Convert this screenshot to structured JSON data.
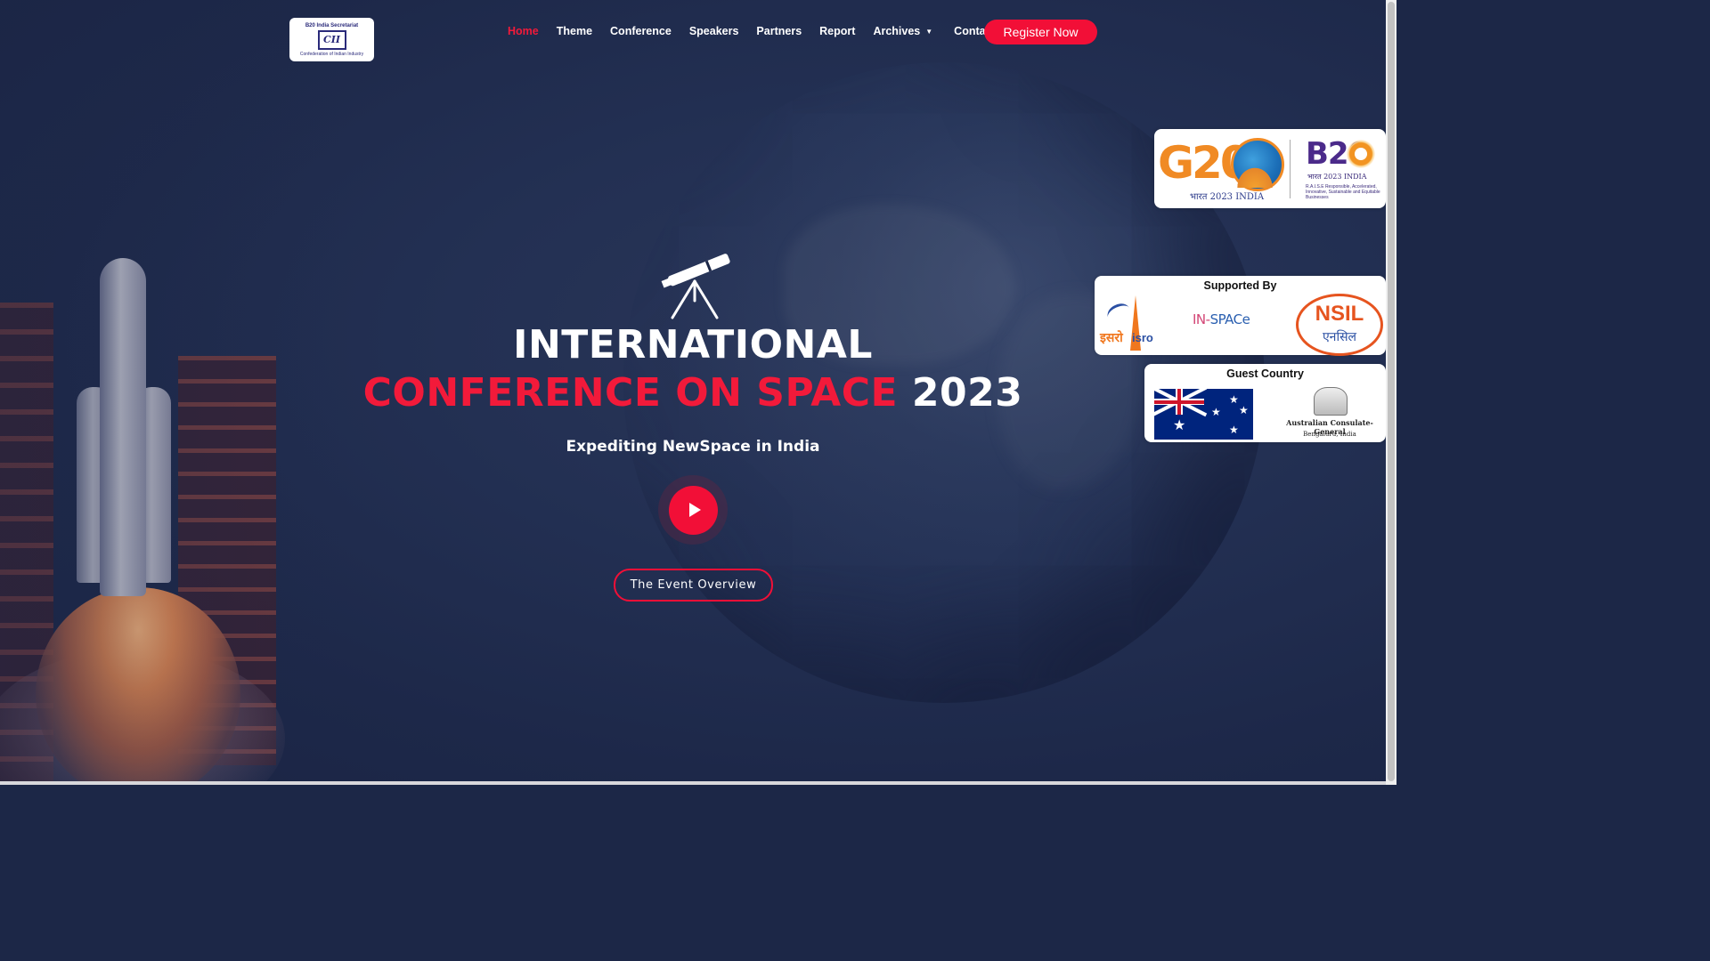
{
  "header": {
    "logo": {
      "top": "B20 India Secretariat",
      "mark": "CII",
      "bottom": "Confederation of Indian Industry"
    },
    "nav": [
      {
        "label": "Home",
        "active": true
      },
      {
        "label": "Theme"
      },
      {
        "label": "Conference"
      },
      {
        "label": "Speakers"
      },
      {
        "label": "Partners"
      },
      {
        "label": "Report"
      },
      {
        "label": "Archives"
      },
      {
        "label": "Contact"
      }
    ],
    "register_label": "Register Now"
  },
  "panels": {
    "g20": {
      "g20_text": "G20",
      "g20_sub": "भारत 2023 INDIA",
      "b20_text": "B20",
      "b20_sub": "भारत 2023 INDIA",
      "b20_raise": "R.A.I.S.E Responsible, Accelerated, Innovative, Sustainable and Equitable Businesses"
    },
    "supported": {
      "title": "Supported By",
      "isro_hindi": "इसरो",
      "isro_en": "isro",
      "inspace_a": "IN-",
      "inspace_b": "SPACe",
      "nsil": "NSIL",
      "nsil_hindi": "एनसिल"
    },
    "guest": {
      "title": "Guest Country",
      "consulate_name": "Australian Consulate-General",
      "consulate_city": "Bengaluru, India"
    }
  },
  "hero": {
    "title_line1": "INTERNATIONAL",
    "title_line2_red": "CONFERENCE ON SPACE",
    "title_line2_white": "2023",
    "subtitle": "Expediting NewSpace in India",
    "overview_label": "The Event Overview"
  },
  "colors": {
    "accent": "#f20f37",
    "background": "#1c2747"
  },
  "icons": {
    "telescope": "telescope-icon",
    "play": "play-icon",
    "caret": "chevron-down-icon"
  }
}
